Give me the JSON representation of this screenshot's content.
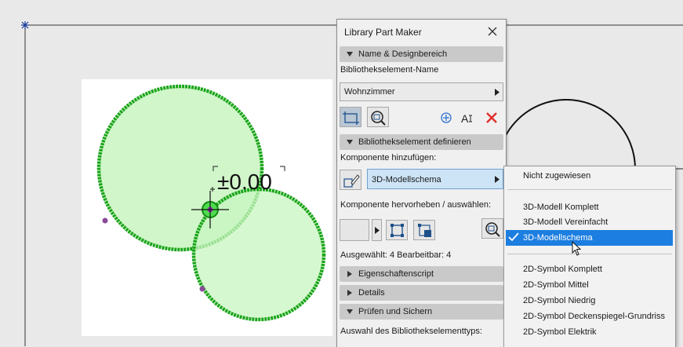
{
  "canvas": {
    "elevation_label": "±0.00"
  },
  "palette": {
    "title": "Library Part Maker",
    "sections": {
      "name": "Name & Designbereich",
      "define": "Bibliothekselement definieren",
      "properties_script": "Eigenschaftenscript",
      "details": "Details",
      "check_save": "Prüfen und Sichern"
    },
    "name_label": "Bibliothekselement-Name",
    "name_value": "Wohnzimmer",
    "add_component_label": "Komponente hinzufügen:",
    "component_value": "3D-Modellschema",
    "highlight_label": "Komponente hervorheben / auswählen:",
    "selection_info": "Ausgewählt: 4 Bearbeitbar: 4",
    "type_label": "Auswahl des Bibliothekselementtyps:"
  },
  "menu": {
    "items": [
      "Nicht zugewiesen",
      "3D-Modell Komplett",
      "3D-Modell Vereinfacht",
      "3D-Modellschema",
      "2D-Symbol Komplett",
      "2D-Symbol Mittel",
      "2D-Symbol Niedrig",
      "2D-Symbol Deckenspiegel-Grundriss",
      "2D-Symbol Elektrik"
    ],
    "selected": "3D-Modellschema"
  },
  "colors": {
    "accent_blue": "#1c7ee0",
    "circle_stroke": "#1aa51a",
    "circle_fill": "#c8f5c0",
    "delete_red": "#e0302a"
  }
}
